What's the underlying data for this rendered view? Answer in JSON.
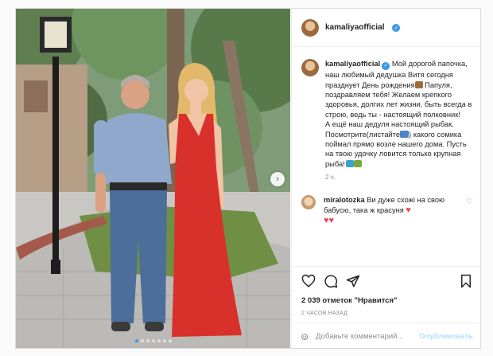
{
  "post": {
    "username": "kamaliyaofficial",
    "verified_icon": "verified-badge-icon",
    "more_label": "•••",
    "caption": {
      "line1": "Мой дорогой папочка, наш любимый дедушка Витя сегодня празднует День рождения",
      "line2": "Папуля, поздравляем тебя! Желаем крепкого здоровья, долгих лет жизни, быть всегда в строю, ведь ты - настоящий полковник!",
      "line3": "А ещё наш дедуля настоящий рыбак. Посмотрите(листайте",
      "line4": ") какого сомика поймал прямо возле нашего дома. Пусть на твою удочку ловится только крупная рыба!"
    },
    "time_ago": "2 ч.",
    "comment": {
      "username": "miralotozka",
      "text": "Ви дуже схожі на свою бабусю, така ж красуня",
      "hearts": "♥"
    },
    "likes_count": "2 039",
    "likes_label": "отметок \"Нравится\"",
    "posted": "2 ЧАСОВ НАЗАД",
    "add_comment_placeholder": "Добавьте комментарий...",
    "publish_label": "Опубликовать",
    "carousel_next": "›",
    "carousel_dots": 7,
    "carousel_active": 1
  },
  "colors": {
    "accent": "#3897f0",
    "heart": "#ed4956",
    "publish_disabled": "#b2dffc",
    "muted": "#8e8e8e",
    "dress": "#d8312b"
  }
}
